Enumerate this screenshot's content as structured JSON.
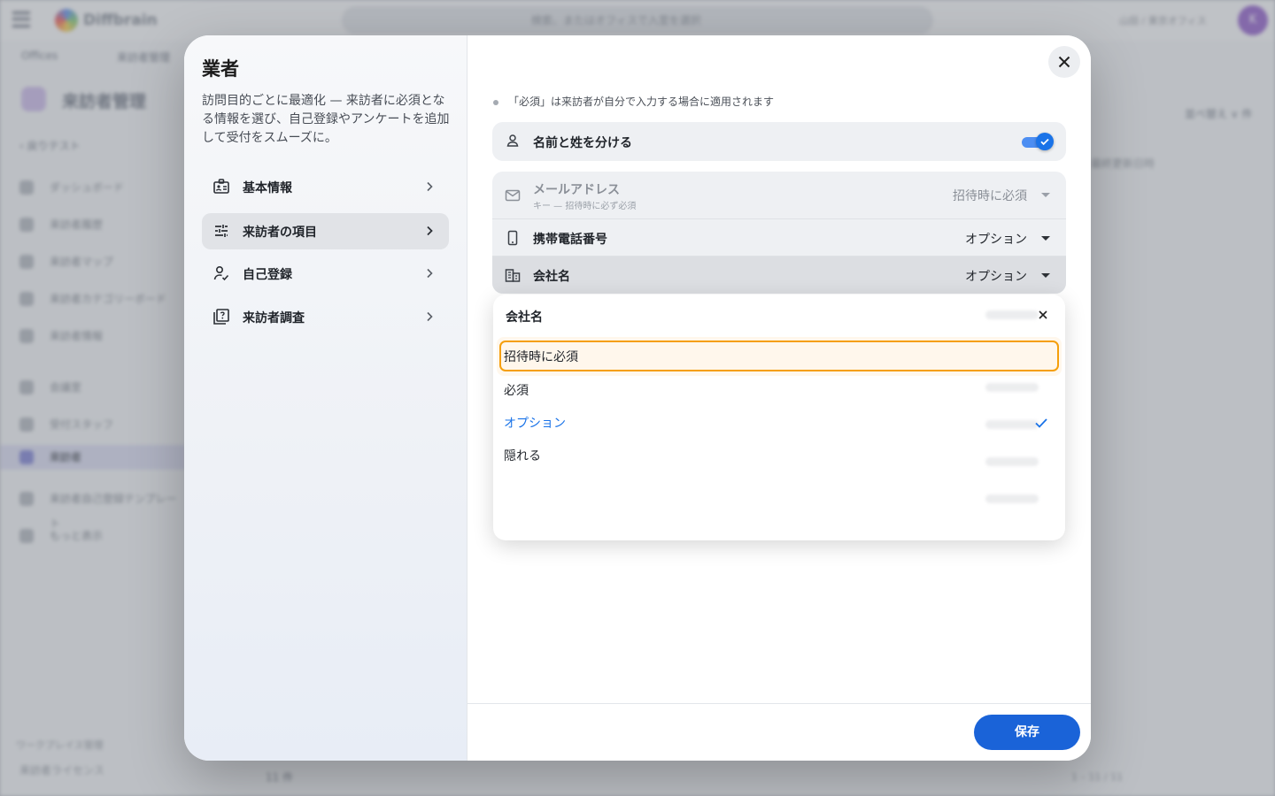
{
  "background": {
    "logo_text": "Diffbrain",
    "search_placeholder": "検索、またはオフィスで入室を選択",
    "org_label": "山田 / 東京オフィス",
    "avatar_initial": "K",
    "breadcrumb": [
      "Offices",
      "来訪者管理"
    ],
    "page_title": "来訪者管理",
    "back_link": "‹ 戻りテスト",
    "sidebar": [
      "ダッシュボード",
      "来訪者履歴",
      "来訪者マップ",
      "来訪者カテゴリーボード",
      "来訪者情報",
      "会議室",
      "受付スタッフ",
      "来訪者",
      "来訪者自己登録テンプレート",
      "もっと表示"
    ],
    "right_link": "並べ替え ∨ 件",
    "right_col": "最終更新日時",
    "section": "ワークプレイス管理",
    "bottom_item": "来訪者ライセンス",
    "footer_count": "11 件",
    "pager": "1 – 11 / 11"
  },
  "modal": {
    "title": "業者",
    "description": "訪問目的ごとに最適化 — 来訪者に必須となる情報を選び、自己登録やアンケートを追加して受付をスムーズに。",
    "nav": [
      {
        "label": "基本情報",
        "icon": "id-card-icon",
        "active": false
      },
      {
        "label": "来訪者の項目",
        "icon": "sliders-icon",
        "active": true
      },
      {
        "label": "自己登録",
        "icon": "person-check-icon",
        "active": false
      },
      {
        "label": "来訪者調査",
        "icon": "survey-icon",
        "active": false
      }
    ],
    "hint": "「必須」は来訪者が自分で入力する場合に適用されます",
    "split_name": {
      "label": "名前と姓を分ける",
      "enabled": true
    },
    "fields": [
      {
        "label": "メールアドレス",
        "sub": "キー — 招待時に必ず必須",
        "value": "招待時に必須",
        "icon": "mail-icon",
        "disabled": true
      },
      {
        "label": "携帯電話番号",
        "value": "オプション",
        "icon": "phone-icon",
        "disabled": false
      },
      {
        "label": "会社名",
        "value": "オプション",
        "icon": "building-icon",
        "disabled": false,
        "selected": true
      }
    ],
    "popup": {
      "title": "会社名",
      "options": [
        {
          "label": "招待時に必須",
          "focused": true,
          "chosen": false
        },
        {
          "label": "必須",
          "focused": false,
          "chosen": false
        },
        {
          "label": "オプション",
          "focused": false,
          "chosen": true
        },
        {
          "label": "隠れる",
          "focused": false,
          "chosen": false
        }
      ]
    },
    "save_label": "保存"
  },
  "colors": {
    "accent": "#1a73e8",
    "focus_ring": "#f59f0b",
    "save_button": "#1a63d8"
  }
}
